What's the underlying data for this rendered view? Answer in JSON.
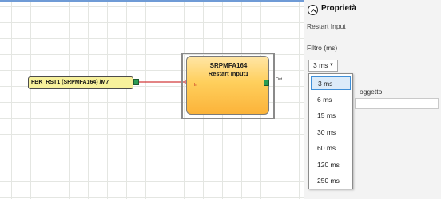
{
  "canvas": {
    "input_tag_label": "FBK_RST1 (SRPMFA164) /M7",
    "block": {
      "title": "SRPMFA164",
      "subtitle": "Restart Input1",
      "in_pin_label": "In",
      "out_pin_label": "Out"
    }
  },
  "panel": {
    "title": "Proprietà",
    "subtitle": "Restart Input",
    "filter_label": "Filtro (ms)",
    "filter_value": "3 ms",
    "hidden_field_label": "oggetto",
    "dropdown_options": [
      "3 ms",
      "6 ms",
      "15 ms",
      "30 ms",
      "60 ms",
      "120 ms",
      "250 ms"
    ],
    "selected_option": "3 ms"
  },
  "colors": {
    "tag_fill": "#f7f19c",
    "block_fill": "#fbb33a",
    "port_green": "#2c9c54",
    "wire_red": "#d23a3a",
    "selection_blue": "#3f8fd8"
  }
}
